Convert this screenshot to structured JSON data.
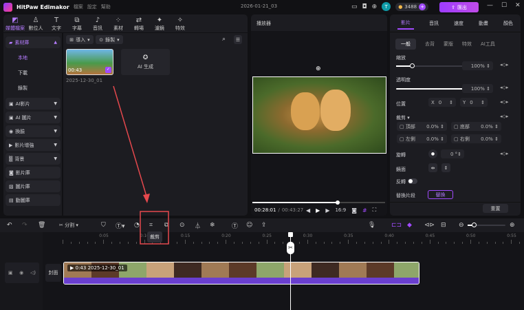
{
  "titlebar": {
    "app_name": "HitPaw Edimakor",
    "menu": [
      "檔案",
      "設定",
      "幫助"
    ],
    "project_name": "2026-01-21_03",
    "credits": "3488",
    "export_label": "匯出",
    "avatar_letter": "T"
  },
  "top_tools": [
    {
      "label": "媒體檔案",
      "icon": "media-icon",
      "active": true
    },
    {
      "label": "數位人",
      "icon": "avatar-icon"
    },
    {
      "label": "文字",
      "icon": "text-icon"
    },
    {
      "label": "字幕",
      "icon": "subtitle-icon"
    },
    {
      "label": "音訊",
      "icon": "music-icon"
    },
    {
      "label": "素材",
      "icon": "elements-icon"
    },
    {
      "label": "轉場",
      "icon": "transition-icon"
    },
    {
      "label": "濾鏡",
      "icon": "filter-icon"
    },
    {
      "label": "特效",
      "icon": "effects-icon"
    }
  ],
  "sidebar": {
    "library": "素材庫",
    "sub": [
      "本地",
      "下載",
      "錄製"
    ],
    "items": [
      {
        "label": "AI影片",
        "dropdown": true
      },
      {
        "label": "AI 圖片",
        "dropdown": true
      },
      {
        "label": "換臉",
        "dropdown": true
      },
      {
        "label": "影片增強",
        "dropdown": true
      },
      {
        "label": "背景",
        "dropdown": true
      },
      {
        "label": "影片庫"
      },
      {
        "label": "圖片庫"
      },
      {
        "label": "動圖庫"
      }
    ]
  },
  "media": {
    "import_label": "導入",
    "record_label": "錄製",
    "clip_duration": "00:43",
    "clip_name": "2025-12-30_01",
    "ai_generate_label": "AI 生成"
  },
  "player": {
    "title": "播放器",
    "current_time": "00:28:01",
    "total_time": "00:43:27",
    "aspect": "16:9",
    "progress_percent": 64
  },
  "props": {
    "tabs": [
      "影片",
      "音訊",
      "速度",
      "動畫",
      "顏色"
    ],
    "active_tab": "影片",
    "subtabs": [
      "一般",
      "去背",
      "蒙版",
      "特效",
      "AI工具"
    ],
    "scale_label": "縮放",
    "scale_value": "100%",
    "scale_percent": 100,
    "opacity_label": "透明度",
    "opacity_value": "100%",
    "position_label": "位置",
    "x_label": "X",
    "x_value": "0",
    "y_label": "Y",
    "y_value": "0",
    "crop_label": "裁剪",
    "crop": [
      {
        "label": "頂部",
        "value": "0.0%"
      },
      {
        "label": "底部",
        "value": "0.0%"
      },
      {
        "label": "左側",
        "value": "0.0%"
      },
      {
        "label": "右側",
        "value": "0.0%"
      }
    ],
    "rotate_label": "旋轉",
    "rotate_value": "0",
    "mirror_label": "鏡面",
    "reverse_label": "反轉",
    "replace_label": "替換片段",
    "replace_btn": "替換",
    "reset_label": "重置"
  },
  "timeline": {
    "split_label": "分割",
    "crop_tooltip": "裁剪",
    "ruler": [
      "0:05",
      "0:10",
      "0:15",
      "0:20",
      "0:25",
      "0:30",
      "0:35",
      "0:40",
      "0:45",
      "0:50",
      "0:55"
    ],
    "cover_label": "封面",
    "clip_label": "0:43 2025-12-30_01",
    "playhead_time": "0:28"
  },
  "colors": {
    "accent": "#a24bff",
    "annotation": "#e5484d"
  }
}
